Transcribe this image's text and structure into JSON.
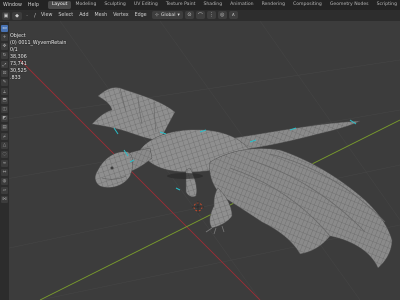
{
  "top_menu": [
    "Window",
    "Help"
  ],
  "workspace_tabs": [
    "Layout",
    "Modeling",
    "Sculpting",
    "UV Editing",
    "Texture Paint",
    "Shading",
    "Animation",
    "Rendering",
    "Compositing",
    "Geometry Nodes",
    "Scripting"
  ],
  "active_workspace": "Layout",
  "viewport_menu": [
    "View",
    "Select",
    "Add",
    "Mesh",
    "Vertex",
    "Edge",
    "Face",
    "UV"
  ],
  "transform_orientation": "Global",
  "stats": {
    "mode": "Object",
    "object": "(0) 0011_WyvernRetain",
    "objects": "0/1",
    "vertices": "38,306",
    "edges": "73,741",
    "faces": "30,525",
    "triangles": ".833"
  },
  "colors": {
    "mesh_fill": "#8e8e8e",
    "mesh_wire": "#5d5d5d",
    "selection_accent": "#2bbfc9",
    "axis_x": "#9b2d35",
    "axis_y": "#7a9c2b",
    "cursor": "#d04a28"
  }
}
